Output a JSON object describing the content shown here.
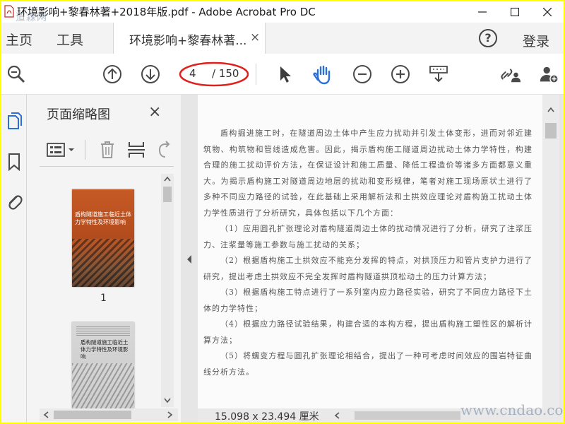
{
  "titlebar": {
    "title": "环境影响+黎春林著+2018年版.pdf - Adobe Acrobat Pro DC",
    "watermark": "道森网"
  },
  "menubar": {
    "home": "主页",
    "tools": "工具",
    "doc_tab": "环境影响+黎春林著...",
    "close_glyph": "×",
    "help_glyph": "?",
    "login": "登录"
  },
  "toolbar": {
    "current_page": "4",
    "total_pages": "/ 150",
    "highlight_color": "#e0201a",
    "accent_color": "#2a6fdb"
  },
  "thumbnails": {
    "title": "页面缩略图",
    "close_glyph": "×",
    "items": [
      {
        "page": "1",
        "cover_title": "盾构隧道施工临近土体力学特性及环境影响"
      },
      {
        "page": "",
        "cover_title": "盾构隧道施工临近土体力学特性及环境影响"
      }
    ]
  },
  "document": {
    "paragraphs": [
      "盾构掘进施工时，在隧道周边土体中产生应力扰动并引发土体变形，进而对邻近建筑物、构筑物和管线造成危害。因此，揭示盾构施工隧道周边扰动土体力学特性，构建合理的施工扰动评价方法，在保证设计和施工质量、降低工程造价等诸多方面都意义重大。为揭示盾构施工对隧道周边地层的扰动和变形规律，笔者对施工现场原状土进行了多种不同应力路径的试验，在此基础上采用解析法和土拱效应理论对盾构施工扰动土体力学性质进行了分析研究，具体包括以下几个方面：",
      "（1）应用圆孔扩张理论对盾构隧道周边土体的扰动情况进行了分析，研究了注浆压力、注浆量等施工参数与施工扰动的关系；",
      "（2）根据盾构施工土拱效应不能充分发挥的特点，对拱顶压力和管片支护力进行了研究，提出考虑土拱效应不完全发挥时盾构隧道拱顶松动土的压力计算方法；",
      "（3）根据盾构施工特点进行了一系列室内应力路径实验，研究了不同应力路径下土体的力学特性；",
      "（4）根据应力路径试验结果，构建合适的本构方程，提出盾构施工塑性区的解析计算方法；",
      "（5）将蠕变方程与圆孔扩张理论相结合，提出了一种可考虑时间效应的围岩特征曲线分析方法。"
    ]
  },
  "statusbar": {
    "page_size": "15.098 x 23.494 厘米",
    "watermark": "www.cndao.com"
  }
}
